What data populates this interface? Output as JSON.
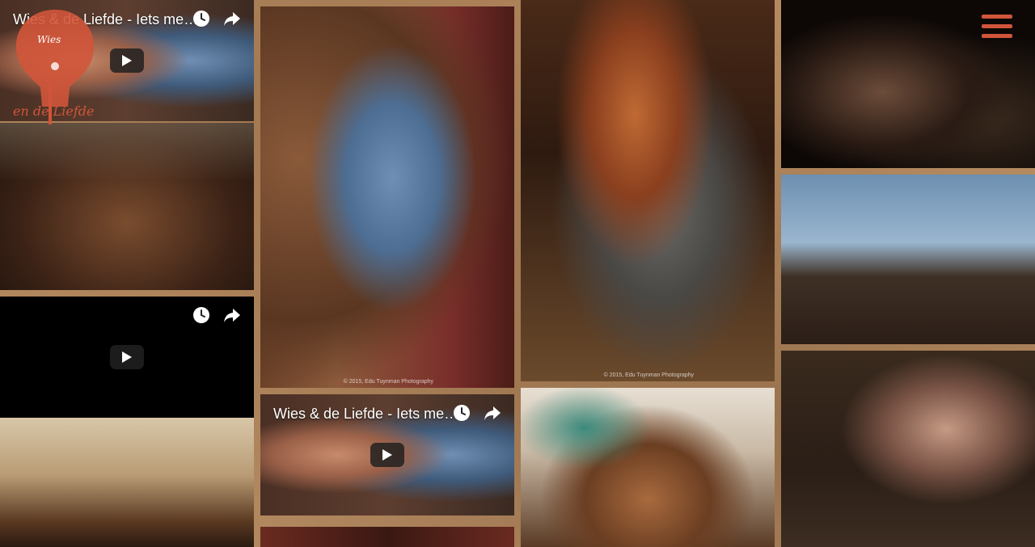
{
  "brand": {
    "logo_top": "Wies",
    "logo_bottom": "en de Liefde",
    "accent_color": "#d0553a"
  },
  "menu": {
    "icon": "hamburger-menu-icon"
  },
  "videos": [
    {
      "title": "Wies & de Liefde - Iets me…",
      "icons": [
        "clock-icon",
        "share-icon",
        "play-icon"
      ]
    },
    {
      "title": "",
      "icons": [
        "clock-icon",
        "share-icon",
        "play-icon"
      ]
    },
    {
      "title": "Wies & de Liefde - Iets me…",
      "icons": [
        "clock-icon",
        "share-icon",
        "play-icon"
      ]
    }
  ],
  "photos": {
    "guitarist_credit": "© 2015, Edu Tuynman Photography",
    "singer_credit": "© 2015, Edu Tuynman Photography"
  }
}
